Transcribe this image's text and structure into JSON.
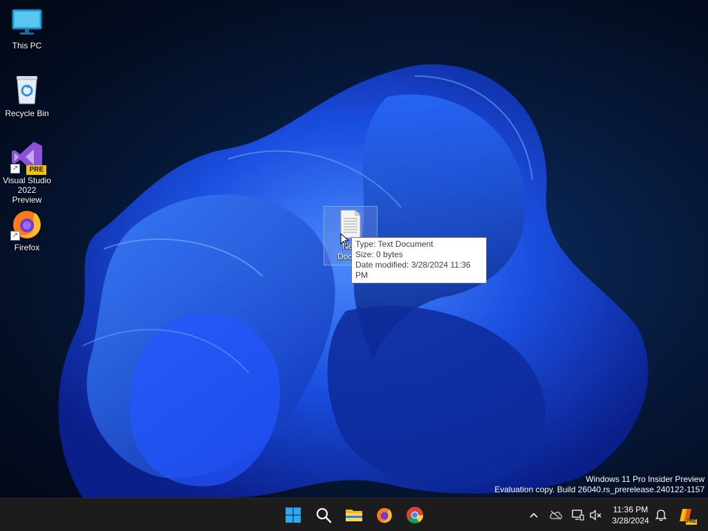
{
  "desktop": {
    "icons": [
      {
        "label": "This PC",
        "icon": "monitor-icon"
      },
      {
        "label": "Recycle Bin",
        "icon": "recycle-bin-icon"
      },
      {
        "label": "Visual Studio 2022 Preview",
        "label_line1": "Visual Studio",
        "label_line2": "2022 Preview",
        "badge": "PRE",
        "icon": "visual-studio-icon"
      },
      {
        "label": "Firefox",
        "icon": "firefox-icon"
      }
    ],
    "selected_file": {
      "label_line1": "New",
      "label_line2": "Docum",
      "icon": "text-document-icon"
    }
  },
  "tooltip": {
    "type": "Type: Text Document",
    "size": "Size: 0 bytes",
    "modified": "Date modified: 3/28/2024 11:36 PM"
  },
  "watermark": {
    "line1": "Windows 11 Pro Insider Preview",
    "line2": "Evaluation copy. Build 26040.rs_prerelease.240122-1157"
  },
  "taskbar": {
    "pinned": [
      "start-icon",
      "search-icon",
      "file-explorer-icon",
      "firefox-icon",
      "chrome-icon"
    ],
    "tray": [
      "chevron-up-icon",
      "onedrive-icon",
      "network-icon",
      "volume-muted-icon",
      "notification-bell-icon",
      "copilot-icon"
    ],
    "copilot_badge": "PRE",
    "clock": {
      "time": "11:36 PM",
      "date": "3/28/2024"
    }
  },
  "colors": {
    "accent": "#0078d4",
    "taskbar": "#1c1c1c",
    "bloom": "#1f5cff"
  }
}
